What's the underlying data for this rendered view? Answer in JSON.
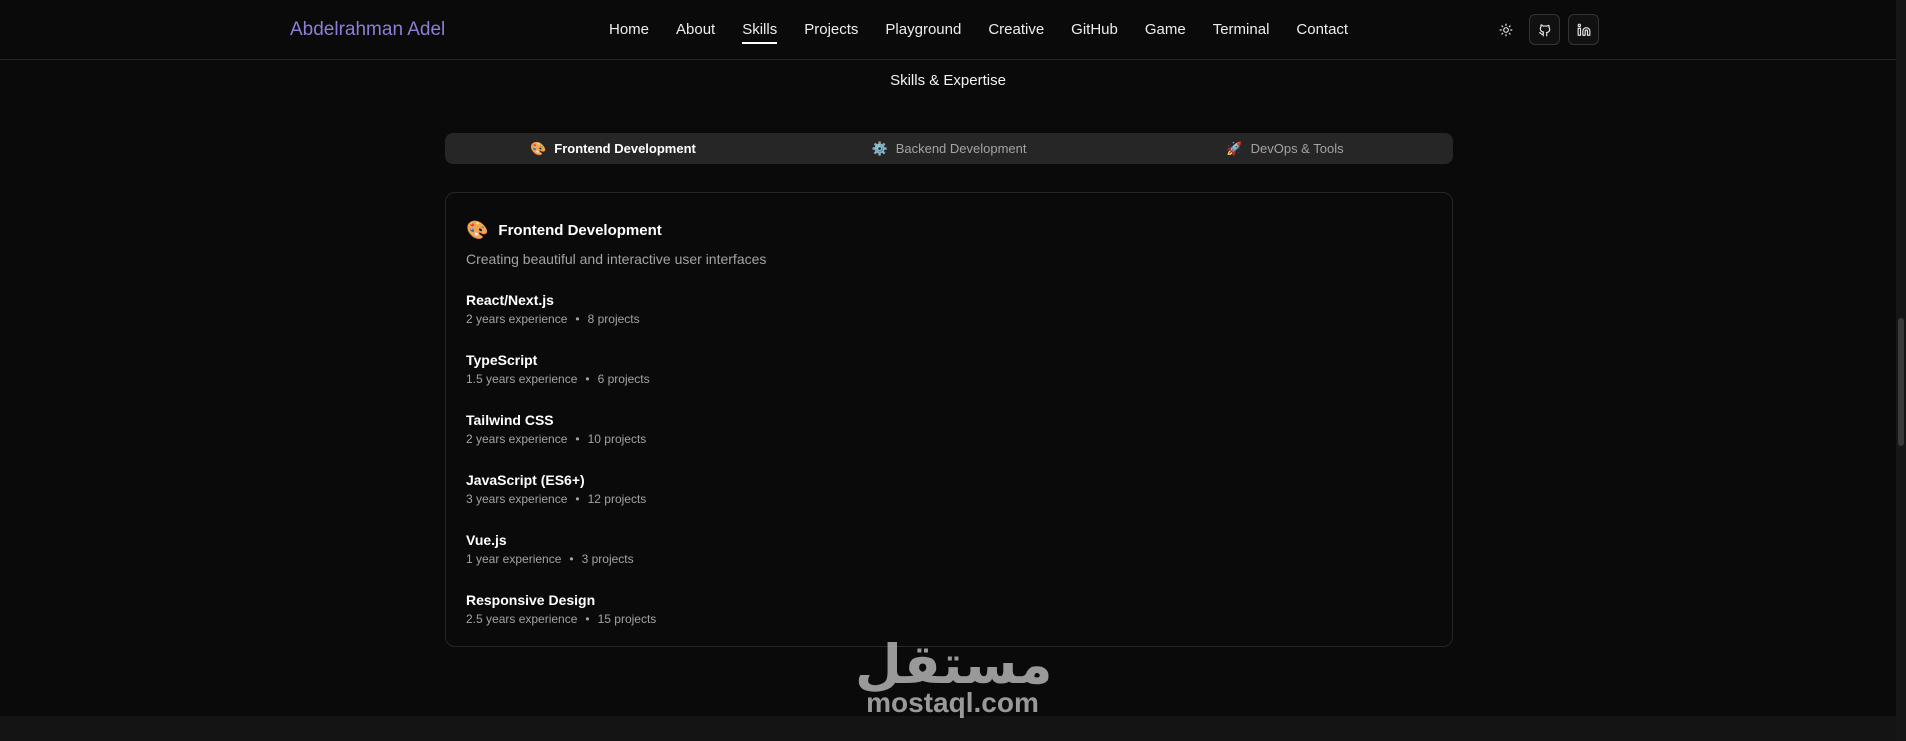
{
  "brand": "Abdelrahman Adel",
  "nav": {
    "links": [
      {
        "label": "Home",
        "active": false
      },
      {
        "label": "About",
        "active": false
      },
      {
        "label": "Skills",
        "active": true
      },
      {
        "label": "Projects",
        "active": false
      },
      {
        "label": "Playground",
        "active": false
      },
      {
        "label": "Creative",
        "active": false
      },
      {
        "label": "GitHub",
        "active": false
      },
      {
        "label": "Game",
        "active": false
      },
      {
        "label": "Terminal",
        "active": false
      },
      {
        "label": "Contact",
        "active": false
      }
    ],
    "actions": {
      "theme_icon": "sun-icon",
      "github_icon": "github-icon",
      "linkedin_icon": "linkedin-icon"
    }
  },
  "section_title": "Skills & Expertise",
  "tabs": [
    {
      "label": "Frontend Development",
      "icon": "🎨",
      "active": true
    },
    {
      "label": "Backend Development",
      "icon": "⚙️",
      "active": false
    },
    {
      "label": "DevOps & Tools",
      "icon": "🚀",
      "active": false
    }
  ],
  "card": {
    "icon": "🎨",
    "title": "Frontend Development",
    "description": "Creating beautiful and interactive user interfaces",
    "skills": [
      {
        "name": "React/Next.js",
        "experience": "2 years experience",
        "projects": "8 projects"
      },
      {
        "name": "TypeScript",
        "experience": "1.5 years experience",
        "projects": "6 projects"
      },
      {
        "name": "Tailwind CSS",
        "experience": "2 years experience",
        "projects": "10 projects"
      },
      {
        "name": "JavaScript (ES6+)",
        "experience": "3 years experience",
        "projects": "12 projects"
      },
      {
        "name": "Vue.js",
        "experience": "1 year experience",
        "projects": "3 projects"
      },
      {
        "name": "Responsive Design",
        "experience": "2.5 years experience",
        "projects": "15 projects"
      }
    ]
  },
  "watermark": {
    "arabic": "مستقل",
    "latin": "mostaql.com"
  },
  "colors": {
    "background": "#0a0a0a",
    "brand": "#8b7fd6",
    "muted_text": "#a3a3a3",
    "tab_bar": "#262626"
  }
}
